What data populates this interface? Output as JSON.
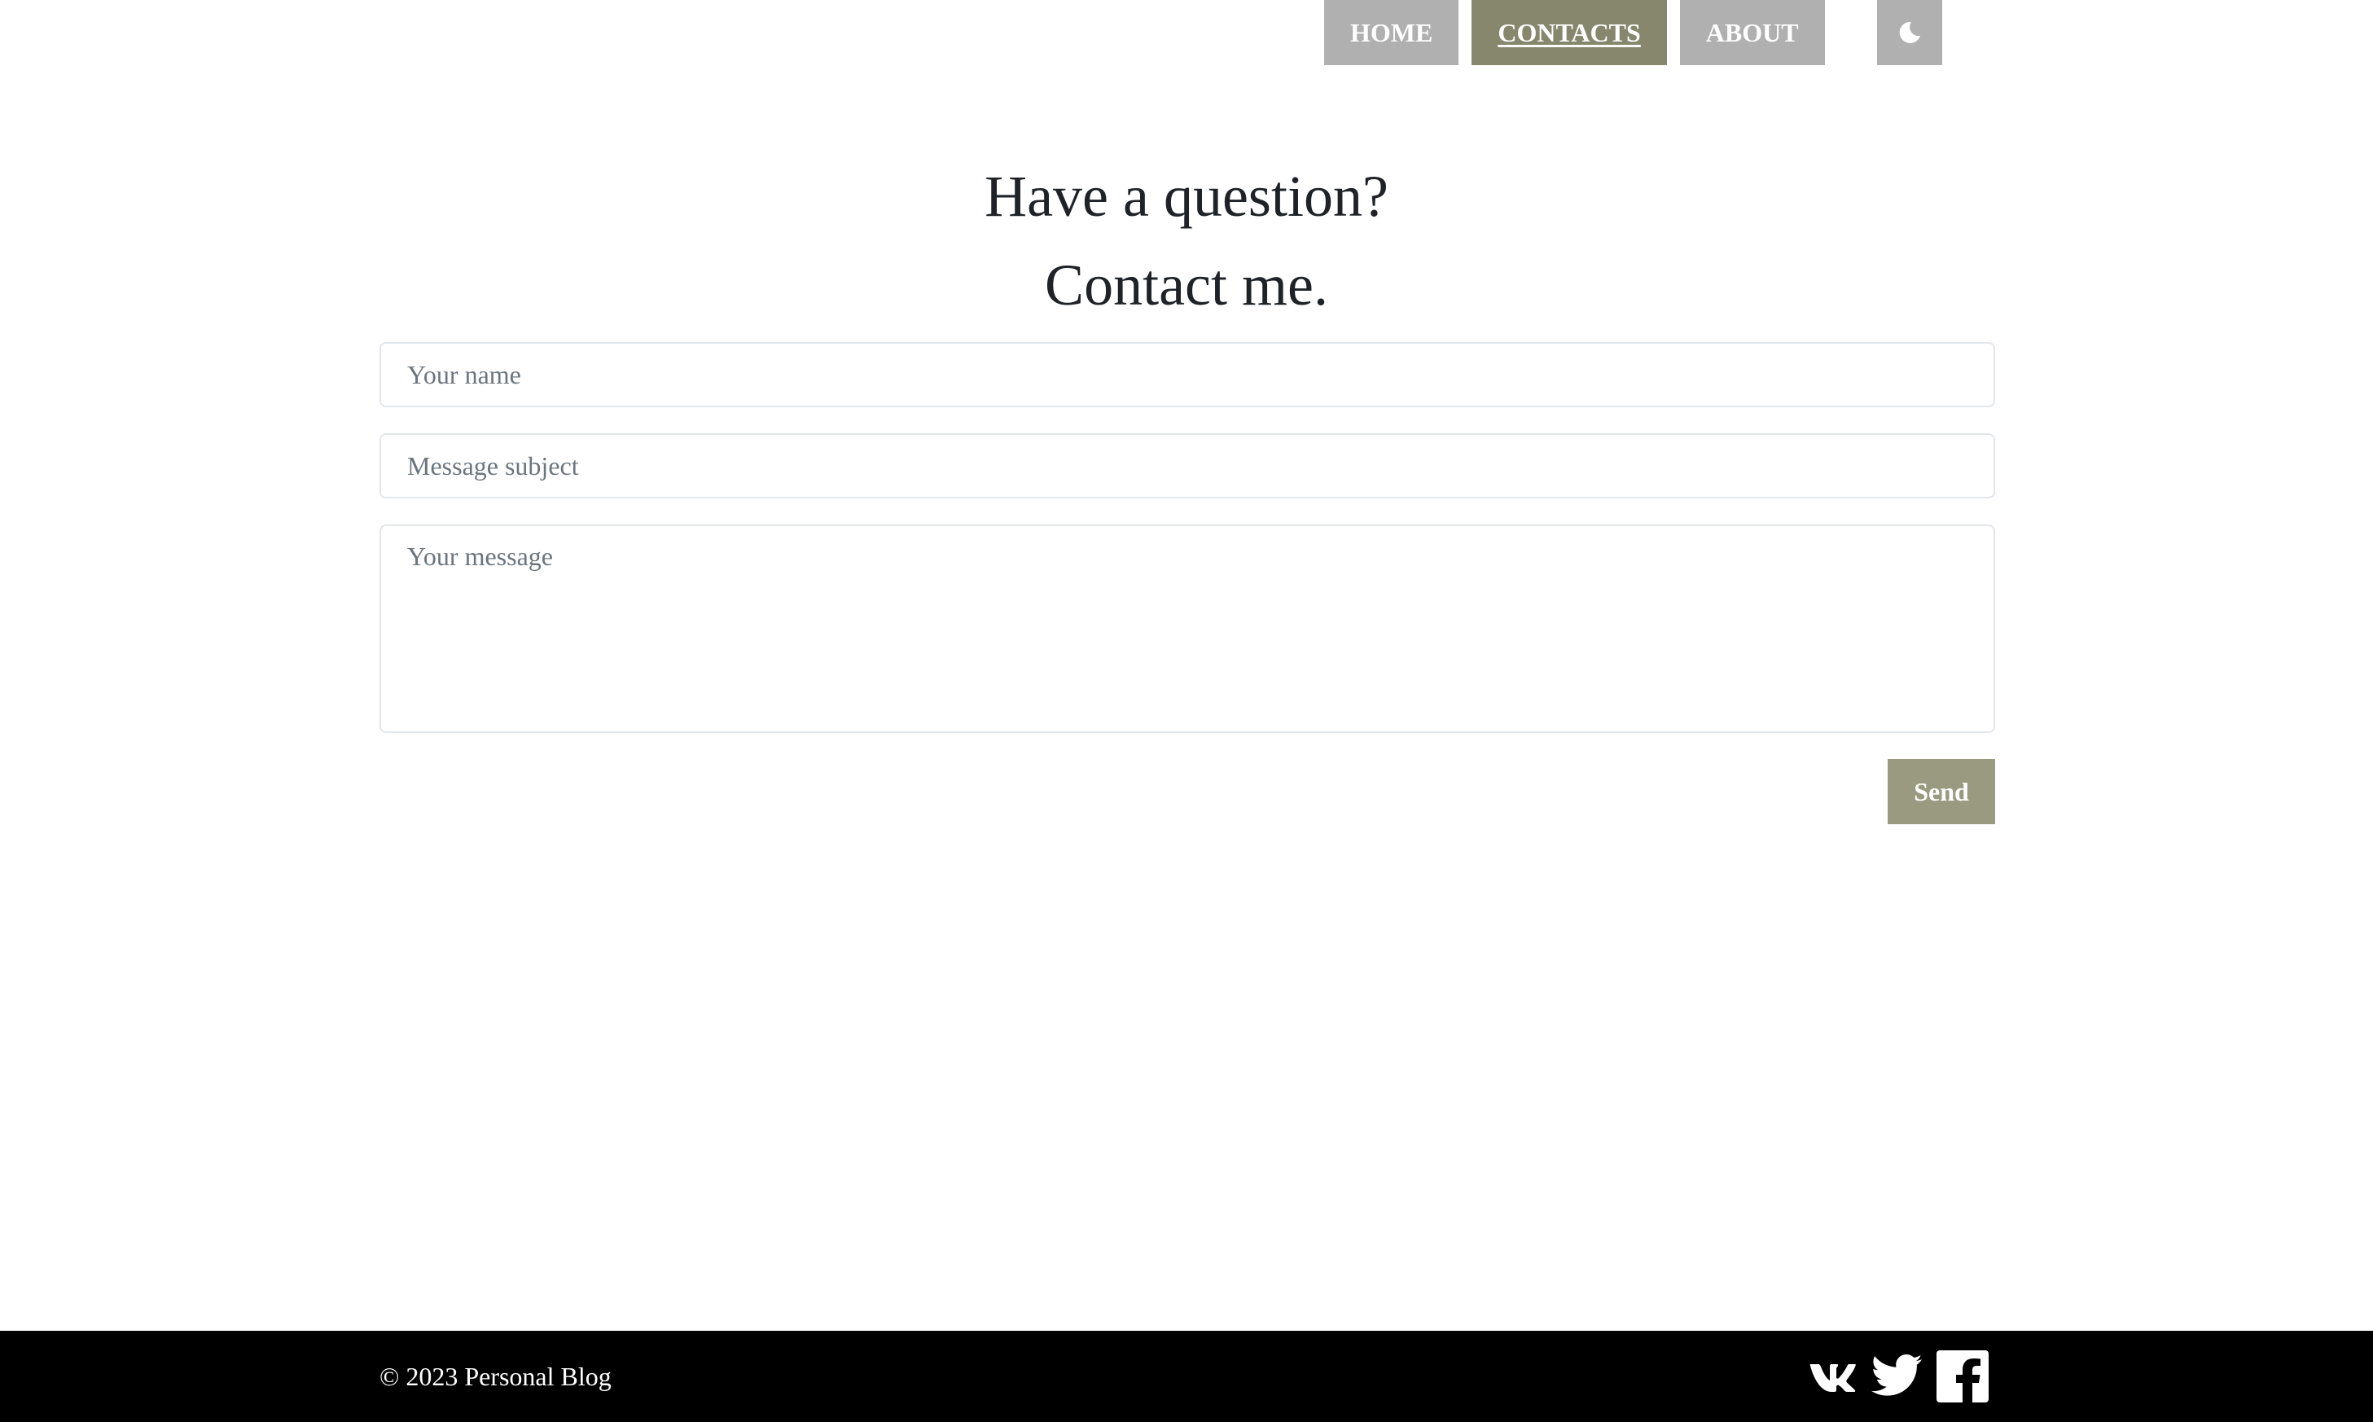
{
  "nav": {
    "items": [
      {
        "label": "HOME",
        "active": false
      },
      {
        "label": "CONTACTS",
        "active": true
      },
      {
        "label": "ABOUT",
        "active": false
      }
    ],
    "theme_toggle_icon": "moon-icon"
  },
  "headings": {
    "line1": "Have a question?",
    "line2": "Contact me."
  },
  "form": {
    "name_placeholder": "Your name",
    "subject_placeholder": "Message subject",
    "message_placeholder": "Your message",
    "send_label": "Send"
  },
  "footer": {
    "copyright": "© 2023 Personal Blog",
    "social_icons": [
      "vk-icon",
      "twitter-icon",
      "facebook-icon"
    ]
  },
  "colors": {
    "nav_inactive": "#b0b0b0",
    "nav_active": "#87876e",
    "send_button": "#9a9a80",
    "footer_bg": "#000000",
    "text": "#1f2328",
    "placeholder": "#6c757d"
  }
}
